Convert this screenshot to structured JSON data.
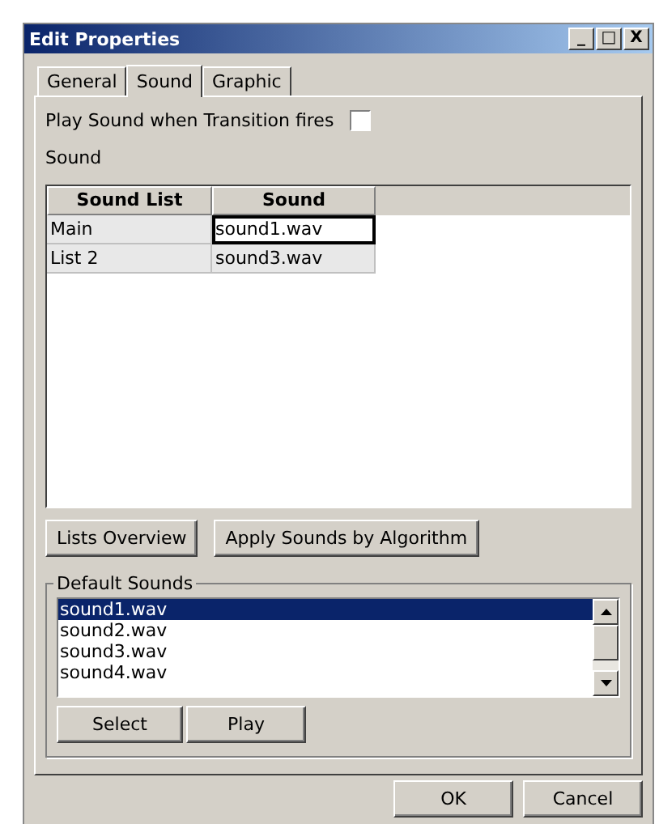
{
  "window": {
    "title": "Edit Properties",
    "controls": [
      "_",
      "□",
      "X"
    ]
  },
  "tabs": [
    {
      "label": "General",
      "selected": false
    },
    {
      "label": "Sound",
      "selected": true
    },
    {
      "label": "Graphic",
      "selected": false
    }
  ],
  "play_sound": {
    "label": "Play Sound when Transition fires",
    "checked": false
  },
  "sound_label": "Sound",
  "table": {
    "columns": [
      "Sound List",
      "Sound"
    ],
    "rows": [
      {
        "cells": [
          "Main",
          "sound1.wav"
        ],
        "editing": true
      },
      {
        "cells": [
          "List 2",
          "sound3.wav"
        ],
        "editing": false
      }
    ]
  },
  "table_buttons": [
    "Lists Overview",
    "Apply Sounds by Algorithm"
  ],
  "default_sounds": {
    "title": "Default Sounds",
    "items": [
      {
        "label": "sound1.wav",
        "selected": true
      },
      {
        "label": "sound2.wav",
        "selected": false
      },
      {
        "label": "sound3.wav",
        "selected": false
      },
      {
        "label": "sound4.wav",
        "selected": false
      }
    ],
    "buttons": [
      "Select",
      "Play"
    ]
  },
  "dialog_buttons": [
    "OK",
    "Cancel"
  ]
}
